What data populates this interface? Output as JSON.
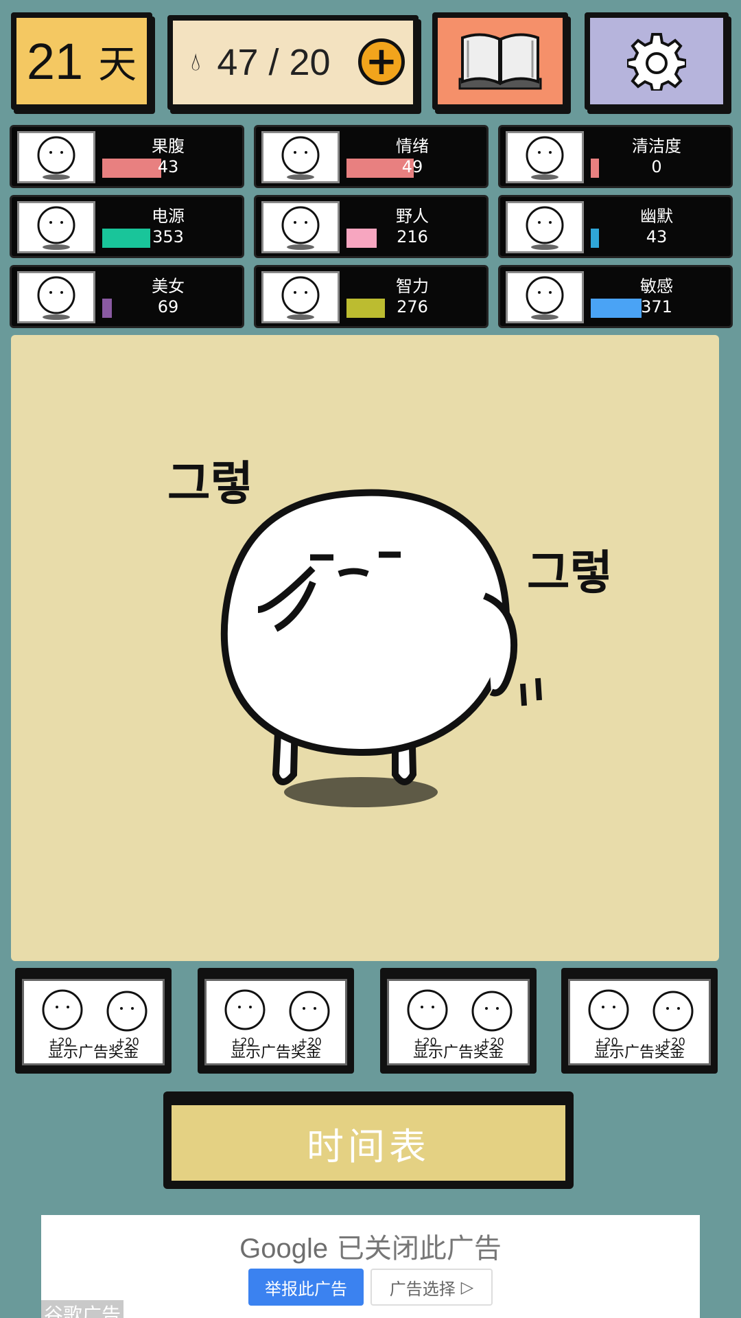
{
  "header": {
    "days_value": "21",
    "days_unit": "天",
    "water_value": "47 / 20"
  },
  "stats": [
    {
      "label": "果腹",
      "value": "43",
      "bar_color": "#e88080",
      "level": 0.43
    },
    {
      "label": "情绪",
      "value": "49",
      "bar_color": "#e88080",
      "level": 0.49
    },
    {
      "label": "清洁度",
      "value": "0",
      "bar_color": "#e88080",
      "level": 0
    },
    {
      "label": "电源",
      "value": "353",
      "bar_color": "#19c59a",
      "level": 0.35
    },
    {
      "label": "野人",
      "value": "216",
      "bar_color": "#f7a6c0",
      "level": 0.22
    },
    {
      "label": "幽默",
      "value": "43",
      "bar_color": "#2fa6d8",
      "level": 0.04
    },
    {
      "label": "美女",
      "value": "69",
      "bar_color": "#8a5aa2",
      "level": 0.07
    },
    {
      "label": "智力",
      "value": "276",
      "bar_color": "#bcbc30",
      "level": 0.28
    },
    {
      "label": "敏感",
      "value": "371",
      "bar_color": "#4aa3f5",
      "level": 0.37
    }
  ],
  "ad_rewards": [
    {
      "label": "显示广告奖金",
      "left_bonus": "+20",
      "right_bonus": "+20"
    },
    {
      "label": "显示广告奖金",
      "left_bonus": "+20",
      "right_bonus": "+20"
    },
    {
      "label": "显示广告奖金",
      "left_bonus": "+20",
      "right_bonus": "+20"
    },
    {
      "label": "显示广告奖金",
      "left_bonus": "+20",
      "right_bonus": "+20"
    }
  ],
  "schedule_button": "时间表",
  "google_ad": {
    "brand": "Google",
    "closed_text": "已关闭此广告",
    "report_button": "举报此广告",
    "choices_button": "广告选择",
    "tag": "谷歌广告"
  },
  "stage": {
    "sound_effect": "그렇",
    "background_color": "#e8dcaa"
  }
}
